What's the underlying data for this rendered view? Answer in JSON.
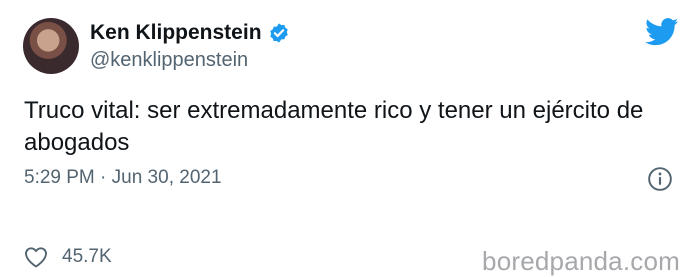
{
  "author": {
    "display_name": "Ken Klippenstein",
    "handle": "@kenklippenstein",
    "verified": true
  },
  "tweet": {
    "text": "Truco vital: ser extremadamente rico y tener un ejército de abogados",
    "timestamp": "5:29 PM · Jun 30, 2021"
  },
  "engagement": {
    "likes": "45.7K"
  },
  "watermark": "boredpanda.com",
  "colors": {
    "twitter_blue": "#1d9bf0",
    "muted_text": "#536471"
  },
  "icons": [
    "verified-badge-icon",
    "twitter-bird-icon",
    "info-icon",
    "heart-icon"
  ]
}
